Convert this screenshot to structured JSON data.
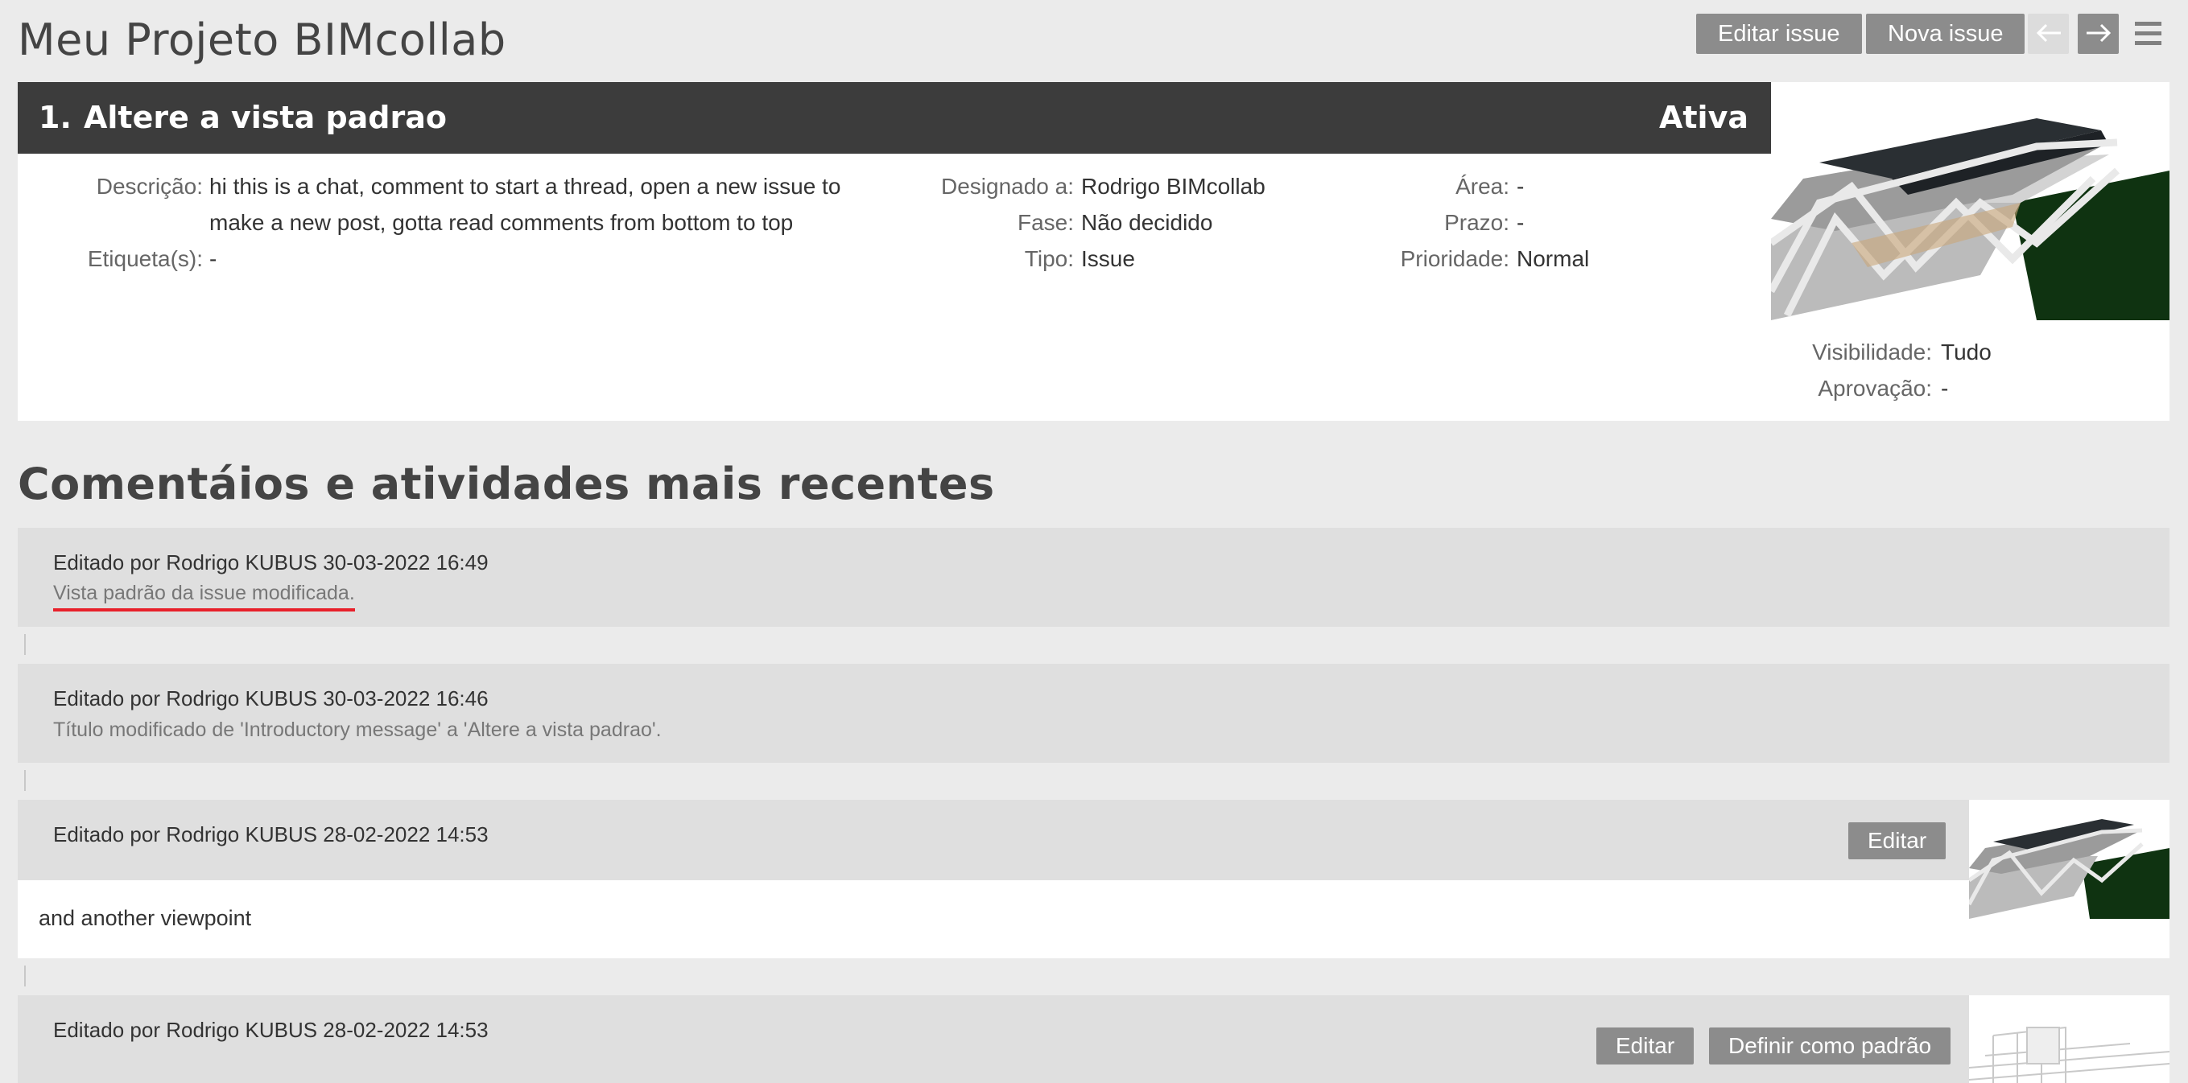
{
  "project": {
    "title": "Meu Projeto BIMcollab"
  },
  "toolbar": {
    "edit_issue": "Editar issue",
    "new_issue": "Nova issue",
    "prev_icon": "arrow-left-icon",
    "next_icon": "arrow-right-icon",
    "menu_icon": "hamburger-menu-icon"
  },
  "issue": {
    "number": "1.",
    "title": "Altere a vista padrao",
    "status": "Ativa",
    "fields": {
      "descricao_label": "Descrição:",
      "descricao_line1": "hi this is a chat, comment to start a thread, open a new issue to",
      "descricao_line2": "make a new post, gotta read comments from bottom to top",
      "etiqueta_label": "Etiqueta(s):",
      "etiqueta_value": "-",
      "designado_label": "Designado a:",
      "designado_value": "Rodrigo BIMcollab",
      "fase_label": "Fase:",
      "fase_value": "Não decidido",
      "tipo_label": "Tipo:",
      "tipo_value": "Issue",
      "area_label": "Área:",
      "area_value": "-",
      "prazo_label": "Prazo:",
      "prazo_value": "-",
      "prioridade_label": "Prioridade:",
      "prioridade_value": "Normal",
      "visibilidade_label": "Visibilidade:",
      "visibilidade_value": "Tudo",
      "aprovacao_label": "Aprovação:",
      "aprovacao_value": "-"
    }
  },
  "activity_section": {
    "title": "Comentáios e atividades mais recentes"
  },
  "activities": [
    {
      "meta": "Editado por Rodrigo KUBUS 30-03-2022 16:49",
      "text": "Vista padrão da issue modificada."
    },
    {
      "meta": "Editado por Rodrigo KUBUS 30-03-2022 16:46",
      "text": "Título modificado de 'Introductory message' a 'Altere a vista padrao'."
    },
    {
      "meta": "Editado por Rodrigo KUBUS 28-02-2022 14:53",
      "edit_label": "Editar",
      "comment": "and another viewpoint"
    },
    {
      "meta": "Editado por Rodrigo KUBUS 28-02-2022 14:53",
      "edit_label": "Editar",
      "set_default_label": "Definir como padrão"
    }
  ],
  "colors": {
    "header_bg": "#3c3c3c",
    "button_bg": "#8c8c8c",
    "page_bg": "#ebebeb",
    "activity_bg": "#dfdfdf",
    "highlight_underline": "#e8202a"
  }
}
